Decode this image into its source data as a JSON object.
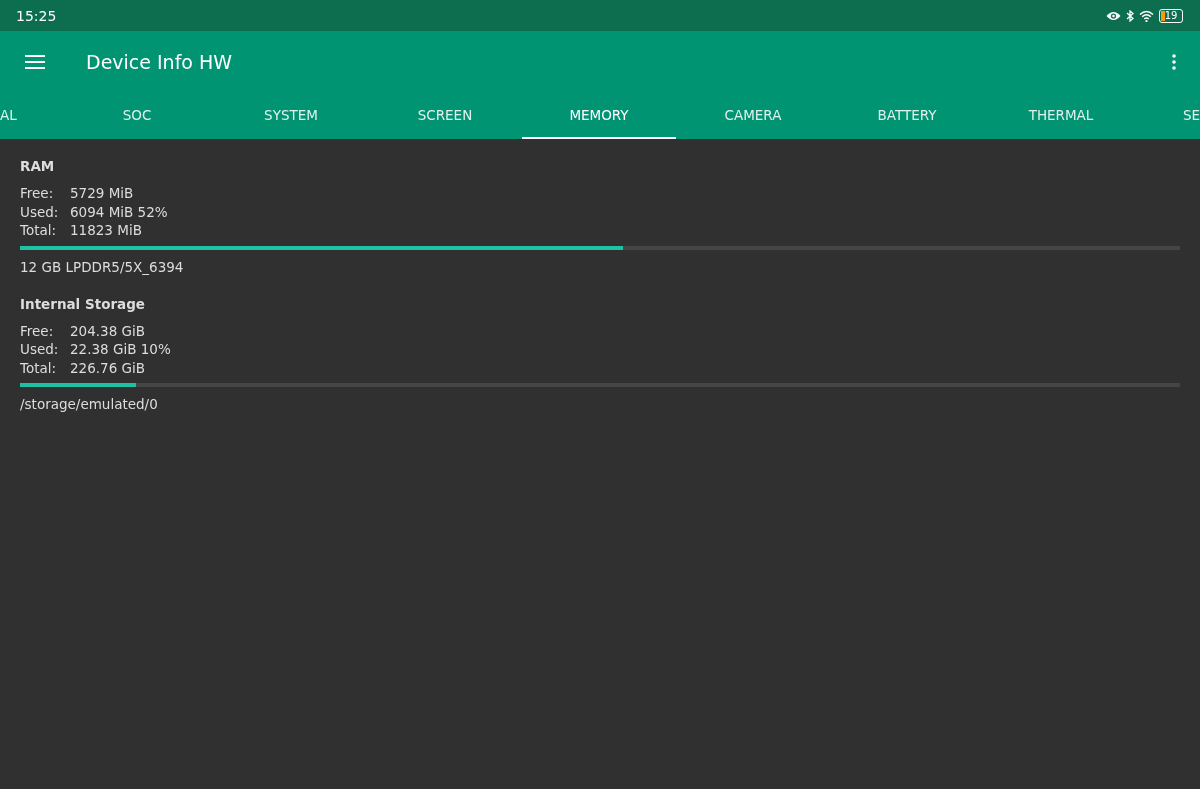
{
  "status_bar": {
    "time": "15:25",
    "battery": "19"
  },
  "app_bar": {
    "title": "Device Info HW"
  },
  "tabs": [
    {
      "label": "AL",
      "selected": false
    },
    {
      "label": "SOC",
      "selected": false
    },
    {
      "label": "SYSTEM",
      "selected": false
    },
    {
      "label": "SCREEN",
      "selected": false
    },
    {
      "label": "MEMORY",
      "selected": true
    },
    {
      "label": "CAMERA",
      "selected": false
    },
    {
      "label": "BATTERY",
      "selected": false
    },
    {
      "label": "THERMAL",
      "selected": false
    },
    {
      "label": "SE",
      "selected": false
    }
  ],
  "sections": [
    {
      "title": "RAM",
      "rows": [
        {
          "label": "Free:",
          "value": "5729 MiB"
        },
        {
          "label": "Used:",
          "value": "6094 MiB 52%"
        },
        {
          "label": "Total:",
          "value": "11823 MiB"
        }
      ],
      "level": 0.52,
      "note": "12 GB LPDDR5/5X_6394"
    },
    {
      "title": "Internal Storage",
      "rows": [
        {
          "label": "Free:",
          "value": "204.38 GiB"
        },
        {
          "label": "Used:",
          "value": "22.38 GiB 10%"
        },
        {
          "label": "Total:",
          "value": "226.76 GiB"
        }
      ],
      "level": 0.1,
      "note": "/storage/emulated/0"
    }
  ]
}
